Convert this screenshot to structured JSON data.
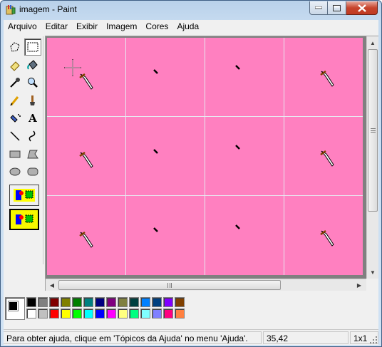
{
  "window": {
    "title": "imagem - Paint"
  },
  "menu": [
    "Arquivo",
    "Editar",
    "Exibir",
    "Imagem",
    "Cores",
    "Ajuda"
  ],
  "tools": [
    {
      "name": "free-form-select-icon",
      "selected": false
    },
    {
      "name": "rect-select-icon",
      "selected": true
    },
    {
      "name": "eraser-icon",
      "selected": false
    },
    {
      "name": "fill-bucket-icon",
      "selected": false
    },
    {
      "name": "color-picker-icon",
      "selected": false
    },
    {
      "name": "magnifier-icon",
      "selected": false
    },
    {
      "name": "pencil-icon",
      "selected": false
    },
    {
      "name": "brush-icon",
      "selected": false
    },
    {
      "name": "airbrush-icon",
      "selected": false
    },
    {
      "name": "text-icon",
      "selected": false,
      "glyph": "A"
    },
    {
      "name": "line-icon",
      "selected": false
    },
    {
      "name": "curve-icon",
      "selected": false
    },
    {
      "name": "rectangle-icon",
      "selected": false
    },
    {
      "name": "polygon-icon",
      "selected": false
    },
    {
      "name": "ellipse-icon",
      "selected": false
    },
    {
      "name": "rounded-rect-icon",
      "selected": false
    }
  ],
  "canvas": {
    "background": "#ff80c0",
    "grid_color": "#e8e8f0"
  },
  "palette": {
    "foreground": "#000000",
    "background": "#ffffff",
    "top_row": [
      "#000000",
      "#808080",
      "#800000",
      "#808000",
      "#008000",
      "#008080",
      "#000080",
      "#800080",
      "#808040",
      "#004040",
      "#0080ff",
      "#004080",
      "#8000ff",
      "#804000"
    ],
    "bottom_row": [
      "#ffffff",
      "#c0c0c0",
      "#ff0000",
      "#ffff00",
      "#00ff00",
      "#00ffff",
      "#0000ff",
      "#ff00ff",
      "#ffff80",
      "#00ff80",
      "#80ffff",
      "#8080ff",
      "#ff0080",
      "#ff8040"
    ]
  },
  "status": {
    "help": "Para obter ajuda, clique em 'Tópicos da Ajuda' no menu 'Ajuda'.",
    "coords": "35,42",
    "size": "1x1"
  }
}
